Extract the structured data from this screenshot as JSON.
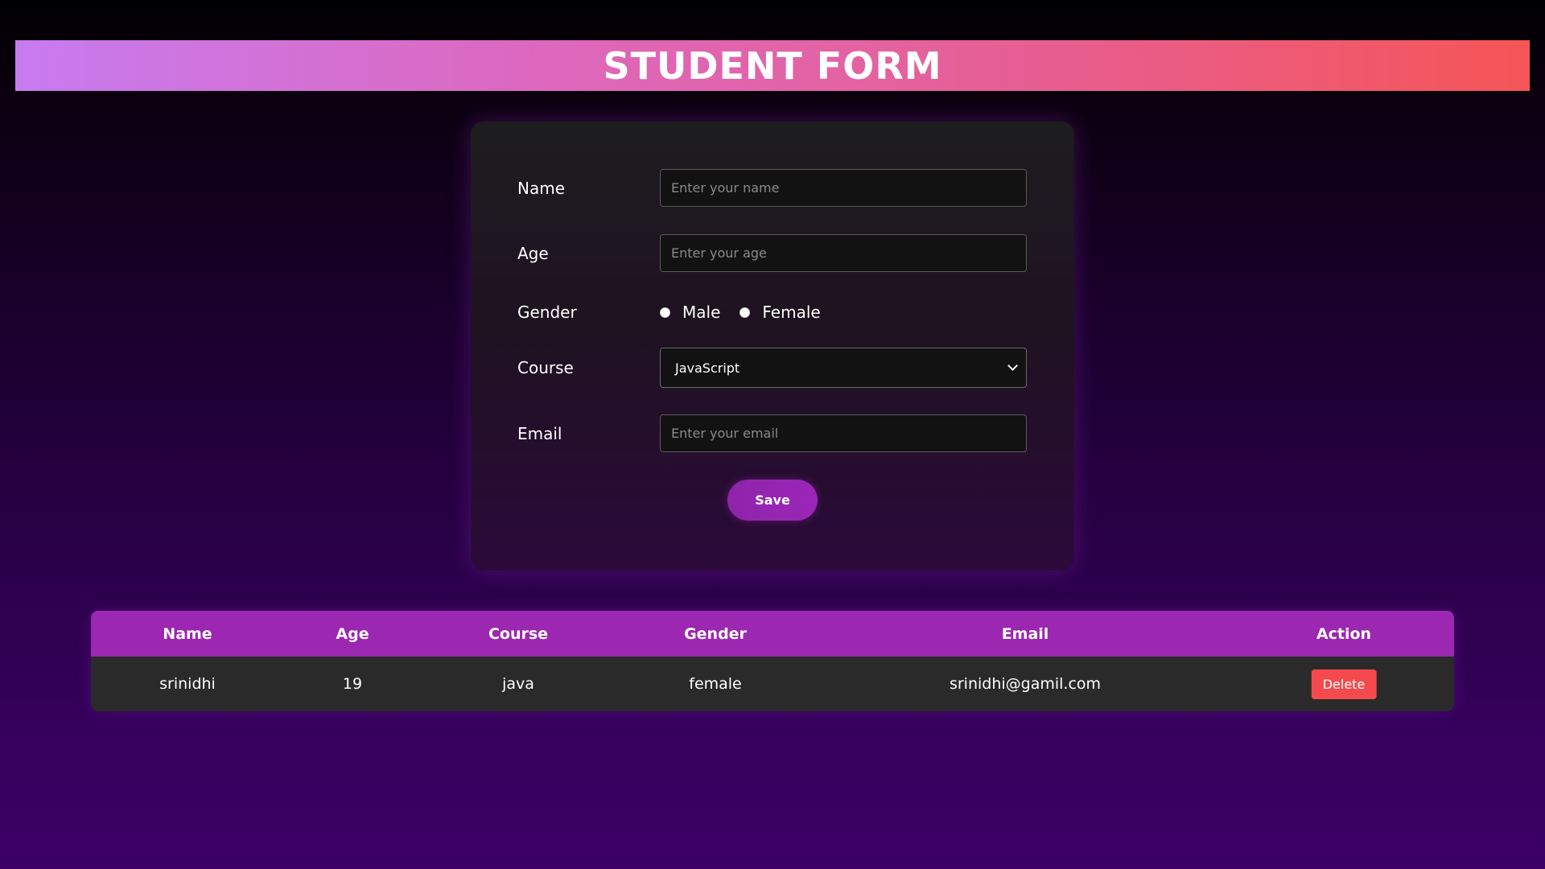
{
  "header": {
    "title": "STUDENT FORM"
  },
  "form": {
    "name": {
      "label": "Name",
      "placeholder": "Enter your name",
      "value": ""
    },
    "age": {
      "label": "Age",
      "placeholder": "Enter your age",
      "value": ""
    },
    "gender": {
      "label": "Gender",
      "options": [
        "Male",
        "Female"
      ],
      "selected": null
    },
    "course": {
      "label": "Course",
      "selected": "JavaScript"
    },
    "email": {
      "label": "Email",
      "placeholder": "Enter your email",
      "value": ""
    },
    "save_label": "Save"
  },
  "table": {
    "headers": [
      "Name",
      "Age",
      "Course",
      "Gender",
      "Email",
      "Action"
    ],
    "rows": [
      {
        "name": "srinidhi",
        "age": "19",
        "course": "java",
        "gender": "female",
        "email": "srinidhi@gamil.com",
        "action": "Delete"
      }
    ]
  },
  "colors": {
    "banner_start": "#c77bf0",
    "banner_end": "#f55556",
    "accent": "#9c27b0",
    "delete": "#f44a4e"
  },
  "icons": {
    "course_dropdown": "chevron-down-icon"
  }
}
